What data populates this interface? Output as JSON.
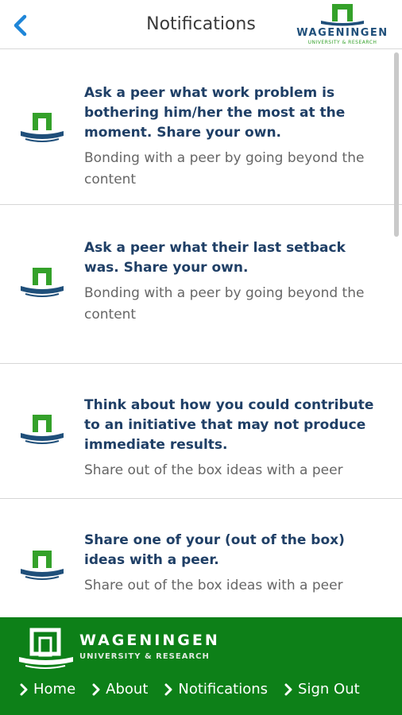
{
  "header": {
    "back_icon": "chevron-left-icon",
    "title": "Notifications",
    "logo_word": "WAGENINGEN",
    "logo_sub": "UNIVERSITY & RESEARCH"
  },
  "notifications": [
    {
      "title": "Ask a peer what work problem is bothering him/her the most at the moment. Share your own.",
      "subtitle": "Bonding with a peer by going beyond the content",
      "icon": "wur-logo-icon"
    },
    {
      "title": "Ask a peer what their last setback was. Share your own.",
      "subtitle": "Bonding with a peer by going beyond the content",
      "icon": "wur-logo-icon"
    },
    {
      "title": "Think about how you could contribute to an initiative that may not produce immediate results.",
      "subtitle": "Share out of the box ideas with a peer",
      "icon": "wur-logo-icon"
    },
    {
      "title": "Share one of your (out of the box) ideas with a peer.",
      "subtitle": "Share out of the box ideas with a peer",
      "icon": "wur-logo-icon"
    }
  ],
  "footer": {
    "logo_word": "WAGENINGEN",
    "logo_sub": "UNIVERSITY & RESEARCH",
    "nav": [
      {
        "label": "Home"
      },
      {
        "label": "About"
      },
      {
        "label": "Notifications"
      },
      {
        "label": "Sign Out"
      }
    ]
  },
  "colors": {
    "accent_blue": "#1f86d8",
    "brand_green": "#0d8018",
    "logo_green": "#34a12a",
    "title_navy": "#1f3f66"
  }
}
